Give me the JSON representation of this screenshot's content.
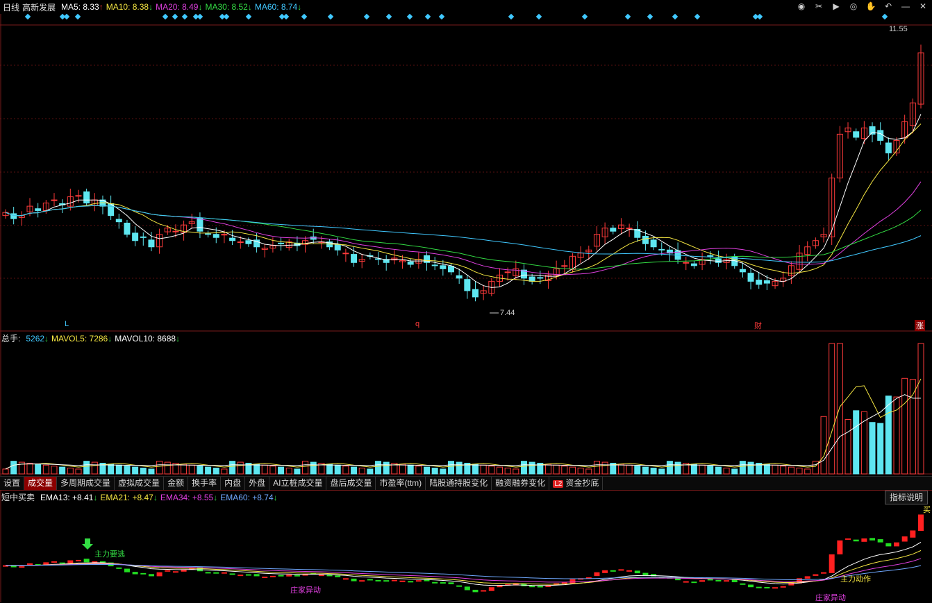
{
  "header": {
    "period": "日线",
    "stock_name": "高新发展",
    "ma": [
      {
        "label": "MA5:",
        "value": "8.33",
        "dir": "↑",
        "color": "#ffffff"
      },
      {
        "label": "MA10:",
        "value": "8.38",
        "dir": "↓",
        "color": "#f5e642"
      },
      {
        "label": "MA20:",
        "value": "8.49",
        "dir": "↓",
        "color": "#e040e0"
      },
      {
        "label": "MA30:",
        "value": "8.52",
        "dir": "↓",
        "color": "#33dd44"
      },
      {
        "label": "MA60:",
        "value": "8.74",
        "dir": "↓",
        "color": "#40c8ff"
      }
    ],
    "toolbar_icons": [
      "eye-icon",
      "scissors-icon",
      "play-icon",
      "record-icon",
      "hand-icon",
      "undo-icon",
      "minus-icon",
      "close-icon"
    ]
  },
  "price_panel": {
    "high_label": "11.55",
    "low_label": "7.44",
    "markers": [
      "L",
      "q",
      "财",
      "涨"
    ]
  },
  "volume_panel": {
    "title": "总手:",
    "items": [
      {
        "label": "",
        "value": "5262",
        "dir": "↓",
        "color": "#40c8ff"
      },
      {
        "label": "MAVOL5:",
        "value": "7286",
        "dir": "↓",
        "color": "#f5e642"
      },
      {
        "label": "MAVOL10:",
        "value": "8688",
        "dir": "↓",
        "color": "#ffffff"
      }
    ]
  },
  "tabs": [
    "设置",
    "成交量",
    "多周期成交量",
    "虚拟成交量",
    "金额",
    "换手率",
    "内盘",
    "外盘",
    "AI立桩成交量",
    "盘后成交量",
    "市盈率(ttm)",
    "陆股通持股变化",
    "融资融券变化",
    "资金抄底"
  ],
  "active_tab": "成交量",
  "l2_badge": "L2",
  "indicator_panel": {
    "title": "短中买卖",
    "items": [
      {
        "label": "EMA13:",
        "value": "+8.41",
        "dir": "↓",
        "color": "#ffffff"
      },
      {
        "label": "EMA21:",
        "value": "+8.47",
        "dir": "↓",
        "color": "#f5e642"
      },
      {
        "label": "EMA34:",
        "value": "+8.55",
        "dir": "↓",
        "color": "#e040e0"
      },
      {
        "label": "EMA60:",
        "value": "+8.74",
        "dir": "↓",
        "color": "#6fa8ff"
      }
    ],
    "help_button": "指标说明",
    "annotations": [
      "主力要逃",
      "庄家异动",
      "庄家异动",
      "主力动作",
      "买"
    ]
  },
  "colors": {
    "up": "#ff3b3b",
    "down": "#5ee6f0",
    "grid": "#5a1010",
    "ma5": "#ffffff",
    "ma10": "#f5e642",
    "ma20": "#e040e0",
    "ma30": "#33dd44",
    "ma60": "#40c8ff"
  },
  "chart_data": [
    {
      "type": "candlestick",
      "title": "高新发展",
      "ylim": [
        7.2,
        11.8
      ],
      "high": 11.55,
      "low": 7.44,
      "series": [
        {
          "name": "MA5",
          "last": 8.33
        },
        {
          "name": "MA10",
          "last": 8.38
        },
        {
          "name": "MA20",
          "last": 8.49
        },
        {
          "name": "MA30",
          "last": 8.52
        },
        {
          "name": "MA60",
          "last": 8.74
        }
      ],
      "closes": [
        8.85,
        8.75,
        8.8,
        8.95,
        8.88,
        9.0,
        9.05,
        8.97,
        9.1,
        9.12,
        9.0,
        9.05,
        8.95,
        8.8,
        8.7,
        8.5,
        8.4,
        8.45,
        8.3,
        8.5,
        8.6,
        8.55,
        8.65,
        8.7,
        8.55,
        8.5,
        8.45,
        8.5,
        8.4,
        8.38,
        8.35,
        8.3,
        8.28,
        8.32,
        8.35,
        8.38,
        8.32,
        8.4,
        8.42,
        8.38,
        8.3,
        8.25,
        8.2,
        8.05,
        8.1,
        8.15,
        8.1,
        8.05,
        8.12,
        8.08,
        8.02,
        8.1,
        8.05,
        8.0,
        7.95,
        7.9,
        7.8,
        7.6,
        7.5,
        7.6,
        7.75,
        7.85,
        7.9,
        7.95,
        7.8,
        7.75,
        7.8,
        7.85,
        7.95,
        8.0,
        8.15,
        8.2,
        8.25,
        8.5,
        8.6,
        8.55,
        8.65,
        8.6,
        8.45,
        8.35,
        8.3,
        8.25,
        8.2,
        8.1,
        8.05,
        8.0,
        8.1,
        8.15,
        8.05,
        8.1,
        8.0,
        7.9,
        7.75,
        7.7,
        7.72,
        7.75,
        7.8,
        8.0,
        8.2,
        8.3,
        8.4,
        8.5,
        9.4,
        10.1,
        10.2,
        10.05,
        10.2,
        10.1,
        10.0,
        9.8,
        10.0,
        10.3,
        10.6,
        11.4
      ],
      "volume": {
        "series": [
          {
            "name": "总手",
            "last": 5262
          },
          {
            "name": "MAVOL5",
            "last": 7286
          },
          {
            "name": "MAVOL10",
            "last": 8688
          }
        ]
      }
    },
    {
      "type": "line",
      "title": "短中买卖",
      "series": [
        {
          "name": "EMA13",
          "last": 8.41
        },
        {
          "name": "EMA21",
          "last": 8.47
        },
        {
          "name": "EMA34",
          "last": 8.55
        },
        {
          "name": "EMA60",
          "last": 8.74
        }
      ]
    }
  ]
}
